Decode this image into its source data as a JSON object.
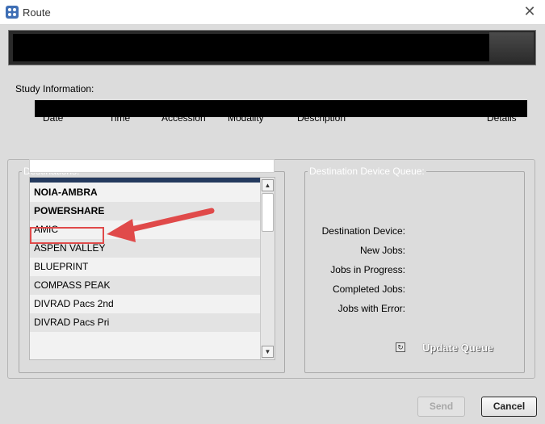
{
  "window": {
    "title": "Route",
    "close_icon": "close-icon",
    "app_icon": "app-grid-icon"
  },
  "study": {
    "section_label": "Study Information:",
    "columns": [
      "Date",
      "Time",
      "Accession",
      "Modality",
      "Description",
      "Details"
    ]
  },
  "destinations": {
    "legend": "Destinations:",
    "filter_value": "",
    "items": [
      "NOIA-AMBRA",
      "POWERSHARE",
      "AMIC",
      "ASPEN VALLEY",
      "BLUEPRINT",
      "COMPASS PEAK",
      "DIVRAD Pacs 2nd",
      "DIVRAD Pacs Pri"
    ]
  },
  "queue": {
    "legend": "Destination Device Queue:",
    "fields": [
      "Destination Device:",
      "New Jobs:",
      "Jobs in Progress:",
      "Completed Jobs:",
      "Jobs with Error:"
    ],
    "update_label": "Update Queue"
  },
  "buttons": {
    "send": "Send",
    "cancel": "Cancel"
  },
  "annotation": {
    "color": "#e04a4a"
  }
}
